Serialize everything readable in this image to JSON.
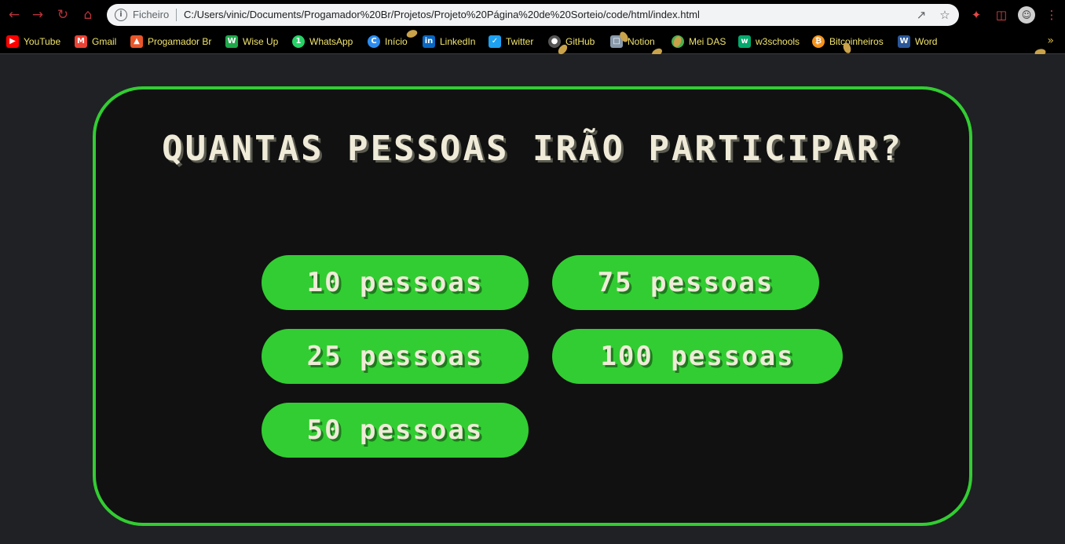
{
  "browser": {
    "scheme_label": "Ficheiro",
    "url": "C:/Users/vinic/Documents/Progamador%20Br/Projetos/Projeto%20Página%20de%20Sorteio/code/html/index.html",
    "bookmarks": [
      {
        "label": "YouTube",
        "icon": "youtube-icon",
        "color": "#ff0000"
      },
      {
        "label": "Gmail",
        "icon": "gmail-icon",
        "color": "#ea4335"
      },
      {
        "label": "Progamador Br",
        "icon": "flame-icon",
        "color": "#e8562a"
      },
      {
        "label": "Wise Up",
        "icon": "wiseup-icon",
        "color": "#1fa84a"
      },
      {
        "label": "WhatsApp",
        "icon": "whatsapp-icon",
        "color": "#25d366"
      },
      {
        "label": "Início",
        "icon": "inicio-icon",
        "color": "#2d8cf0"
      },
      {
        "label": "LinkedIn",
        "icon": "linkedin-icon",
        "color": "#0a66c2"
      },
      {
        "label": "Twitter",
        "icon": "twitter-icon",
        "color": "#1da1f2"
      },
      {
        "label": "GitHub",
        "icon": "github-icon",
        "color": "#555555"
      },
      {
        "label": "Notion",
        "icon": "notion-icon",
        "color": "#8899aa"
      },
      {
        "label": "Mei DAS",
        "icon": "meidas-icon",
        "color": "#4caf50"
      },
      {
        "label": "w3schools",
        "icon": "w3schools-icon",
        "color": "#04aa6d"
      },
      {
        "label": "Bitcoinheiros",
        "icon": "bitcoinheiros-icon",
        "color": "#f7931a"
      },
      {
        "label": "Word",
        "icon": "word-icon",
        "color": "#2b579a"
      }
    ]
  },
  "page": {
    "title": "Quantas pessoas irão participar?",
    "options": [
      {
        "label": "10 pessoas"
      },
      {
        "label": "75 pessoas"
      },
      {
        "label": "25 pessoas"
      },
      {
        "label": "100 pessoas"
      },
      {
        "label": "50 pessoas"
      }
    ]
  },
  "colors": {
    "accent": "#32cd32",
    "card_bg": "#111111",
    "page_bg": "#202124",
    "text": "#efebd8"
  }
}
